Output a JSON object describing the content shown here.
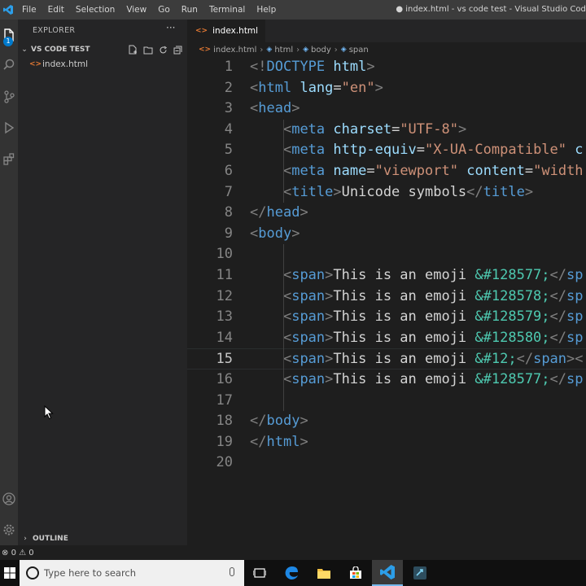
{
  "menubar": {
    "items": [
      "File",
      "Edit",
      "Selection",
      "View",
      "Go",
      "Run",
      "Terminal",
      "Help"
    ],
    "window_title": "● index.html - vs code test - Visual Studio Code"
  },
  "activity": {
    "explorer_badge": "1",
    "icons": [
      "files-icon",
      "search-icon",
      "source-control-icon",
      "run-debug-icon",
      "extensions-icon",
      "account-icon",
      "settings-gear-icon"
    ]
  },
  "sidebar": {
    "title": "EXPLORER",
    "more": "···",
    "folder_name": "VS CODE TEST",
    "files": [
      {
        "name": "index.html",
        "icon": "html-file-icon"
      }
    ],
    "outline_label": "OUTLINE"
  },
  "tabs": [
    {
      "label": "index.html",
      "dirty": true
    }
  ],
  "breadcrumb": [
    "index.html",
    "html",
    "body",
    "span"
  ],
  "editor": {
    "active_line": 15,
    "lines": [
      {
        "n": "1",
        "tokens": [
          [
            "punct",
            "<!"
          ],
          [
            "doc",
            "DOCTYPE"
          ],
          [
            "text",
            " "
          ],
          [
            "attr",
            "html"
          ],
          [
            "punct",
            ">"
          ]
        ]
      },
      {
        "n": "2",
        "tokens": [
          [
            "punct",
            "<"
          ],
          [
            "tag",
            "html"
          ],
          [
            "text",
            " "
          ],
          [
            "attr",
            "lang"
          ],
          [
            "text",
            "="
          ],
          [
            "str",
            "\"en\""
          ],
          [
            "punct",
            ">"
          ]
        ]
      },
      {
        "n": "3",
        "tokens": [
          [
            "punct",
            "<"
          ],
          [
            "tag",
            "head"
          ],
          [
            "punct",
            ">"
          ]
        ]
      },
      {
        "n": "4",
        "tokens": [
          [
            "text",
            "    "
          ],
          [
            "punct",
            "<"
          ],
          [
            "tag",
            "meta"
          ],
          [
            "text",
            " "
          ],
          [
            "attr",
            "charset"
          ],
          [
            "text",
            "="
          ],
          [
            "str",
            "\"UTF-8\""
          ],
          [
            "punct",
            ">"
          ]
        ]
      },
      {
        "n": "5",
        "tokens": [
          [
            "text",
            "    "
          ],
          [
            "punct",
            "<"
          ],
          [
            "tag",
            "meta"
          ],
          [
            "text",
            " "
          ],
          [
            "attr",
            "http-equiv"
          ],
          [
            "text",
            "="
          ],
          [
            "str",
            "\"X-UA-Compatible\""
          ],
          [
            "text",
            " "
          ],
          [
            "attr",
            "c"
          ]
        ]
      },
      {
        "n": "6",
        "tokens": [
          [
            "text",
            "    "
          ],
          [
            "punct",
            "<"
          ],
          [
            "tag",
            "meta"
          ],
          [
            "text",
            " "
          ],
          [
            "attr",
            "name"
          ],
          [
            "text",
            "="
          ],
          [
            "str",
            "\"viewport\""
          ],
          [
            "text",
            " "
          ],
          [
            "attr",
            "content"
          ],
          [
            "text",
            "="
          ],
          [
            "str",
            "\"width"
          ]
        ]
      },
      {
        "n": "7",
        "tokens": [
          [
            "text",
            "    "
          ],
          [
            "punct",
            "<"
          ],
          [
            "tag",
            "title"
          ],
          [
            "punct",
            ">"
          ],
          [
            "text",
            "Unicode symbols"
          ],
          [
            "punct",
            "</"
          ],
          [
            "tag",
            "title"
          ],
          [
            "punct",
            ">"
          ]
        ]
      },
      {
        "n": "8",
        "tokens": [
          [
            "punct",
            "</"
          ],
          [
            "tag",
            "head"
          ],
          [
            "punct",
            ">"
          ]
        ]
      },
      {
        "n": "9",
        "tokens": [
          [
            "punct",
            "<"
          ],
          [
            "tag",
            "body"
          ],
          [
            "punct",
            ">"
          ]
        ]
      },
      {
        "n": "10",
        "tokens": []
      },
      {
        "n": "11",
        "tokens": [
          [
            "text",
            "    "
          ],
          [
            "punct",
            "<"
          ],
          [
            "tag",
            "span"
          ],
          [
            "punct",
            ">"
          ],
          [
            "text",
            "This is an emoji "
          ],
          [
            "ent",
            "&#128577;"
          ],
          [
            "punct",
            "</"
          ],
          [
            "tag",
            "sp"
          ]
        ]
      },
      {
        "n": "12",
        "tokens": [
          [
            "text",
            "    "
          ],
          [
            "punct",
            "<"
          ],
          [
            "tag",
            "span"
          ],
          [
            "punct",
            ">"
          ],
          [
            "text",
            "This is an emoji "
          ],
          [
            "ent",
            "&#128578;"
          ],
          [
            "punct",
            "</"
          ],
          [
            "tag",
            "sp"
          ]
        ]
      },
      {
        "n": "13",
        "tokens": [
          [
            "text",
            "    "
          ],
          [
            "punct",
            "<"
          ],
          [
            "tag",
            "span"
          ],
          [
            "punct",
            ">"
          ],
          [
            "text",
            "This is an emoji "
          ],
          [
            "ent",
            "&#128579;"
          ],
          [
            "punct",
            "</"
          ],
          [
            "tag",
            "sp"
          ]
        ]
      },
      {
        "n": "14",
        "tokens": [
          [
            "text",
            "    "
          ],
          [
            "punct",
            "<"
          ],
          [
            "tag",
            "span"
          ],
          [
            "punct",
            ">"
          ],
          [
            "text",
            "This is an emoji "
          ],
          [
            "ent",
            "&#128580;"
          ],
          [
            "punct",
            "</"
          ],
          [
            "tag",
            "sp"
          ]
        ]
      },
      {
        "n": "15",
        "tokens": [
          [
            "text",
            "    "
          ],
          [
            "punct",
            "<"
          ],
          [
            "tag",
            "span"
          ],
          [
            "punct",
            ">"
          ],
          [
            "text",
            "This is an emoji "
          ],
          [
            "ent",
            "&#12;"
          ],
          [
            "punct",
            "</"
          ],
          [
            "tag",
            "span"
          ],
          [
            "punct",
            ">"
          ],
          [
            "punct",
            "<"
          ]
        ]
      },
      {
        "n": "16",
        "tokens": [
          [
            "text",
            "    "
          ],
          [
            "punct",
            "<"
          ],
          [
            "tag",
            "span"
          ],
          [
            "punct",
            ">"
          ],
          [
            "text",
            "This is an emoji "
          ],
          [
            "ent",
            "&#128577;"
          ],
          [
            "punct",
            "</"
          ],
          [
            "tag",
            "sp"
          ]
        ]
      },
      {
        "n": "17",
        "tokens": []
      },
      {
        "n": "18",
        "tokens": [
          [
            "punct",
            "</"
          ],
          [
            "tag",
            "body"
          ],
          [
            "punct",
            ">"
          ]
        ]
      },
      {
        "n": "19",
        "tokens": [
          [
            "punct",
            "</"
          ],
          [
            "tag",
            "html"
          ],
          [
            "punct",
            ">"
          ]
        ]
      },
      {
        "n": "20",
        "tokens": []
      }
    ]
  },
  "statusbar": {
    "errors": "0",
    "warnings": "0"
  },
  "taskbar": {
    "search_placeholder": "Type here to search",
    "apps": [
      "task-view-icon",
      "edge-icon",
      "file-explorer-icon",
      "store-icon",
      "vscode-icon",
      "app-icon"
    ]
  },
  "colors": {
    "tag": "#569cd6",
    "attr": "#9cdcfe",
    "string": "#ce9178",
    "text": "#d4d4d4",
    "entity": "#4ec9b0",
    "line_number": "#858585",
    "accent": "#007acc"
  }
}
